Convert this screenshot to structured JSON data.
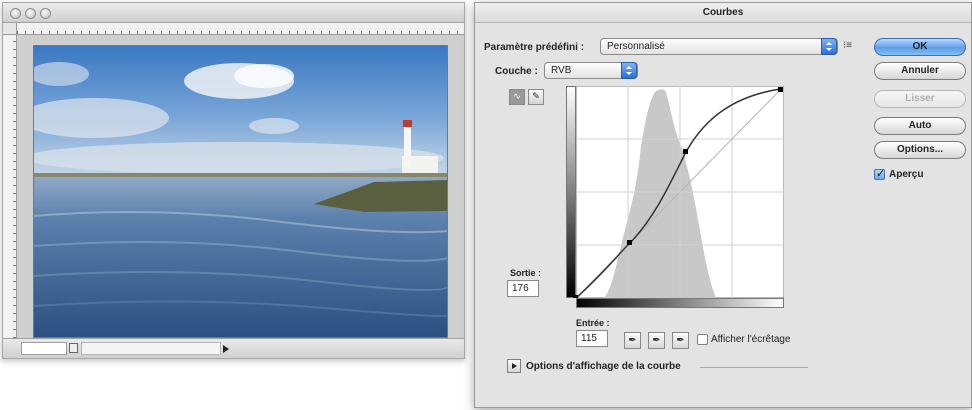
{
  "document": {
    "title": "",
    "zoom": "",
    "info": ""
  },
  "dialog": {
    "title": "Courbes",
    "preset_label": "Paramètre prédéfini :",
    "preset_value": "Personnalisé",
    "preset_menu_glyph": "⁝≡",
    "channel_label": "Couche :",
    "channel_value": "RVB",
    "buttons": {
      "ok": "OK",
      "cancel": "Annuler",
      "smooth": "Lisser",
      "auto": "Auto",
      "options": "Options..."
    },
    "preview_label": "Aperçu",
    "preview_checked": true,
    "output_label": "Sortie :",
    "output_value": "176",
    "input_label": "Entrée :",
    "input_value": "115",
    "show_clipping_label": "Afficher l'écrêtage",
    "display_options_label": "Options d'affichage de la courbe"
  },
  "colors": {
    "accent": "#5e9ee8",
    "dialog_bg": "#e3e3e3",
    "histogram": "#c8c8c8"
  }
}
